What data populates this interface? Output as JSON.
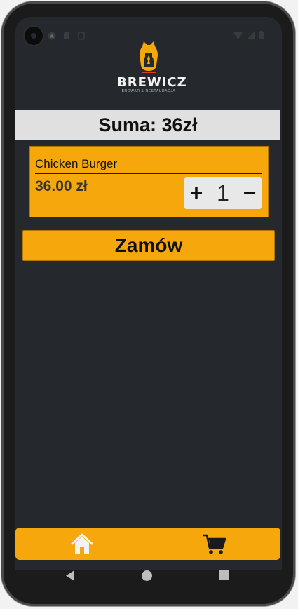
{
  "app": {
    "logo_text": "BREWICZ",
    "logo_subtitle": "BROWAR & RESTAURACJA"
  },
  "cart": {
    "sum_label": "Suma: 36zł",
    "items": [
      {
        "name": "Chicken Burger",
        "price": "36.00 zł",
        "quantity": "1",
        "plus": "+",
        "minus": "−"
      }
    ],
    "order_button": "Zamów"
  },
  "bottom_nav": {
    "items": [
      {
        "icon": "home-icon"
      },
      {
        "icon": "cart-icon"
      }
    ]
  },
  "colors": {
    "accent": "#f5a70b",
    "background": "#25282c",
    "sum_bar": "#e0e0e0"
  }
}
